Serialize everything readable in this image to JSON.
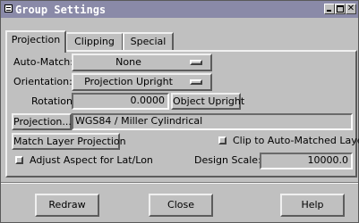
{
  "window": {
    "title": "Group Settings",
    "controls": [
      "minimize",
      "maximize",
      "close"
    ]
  },
  "tabs": [
    {
      "label": "Projection",
      "active": true
    },
    {
      "label": "Clipping",
      "active": false
    },
    {
      "label": "Special",
      "active": false
    }
  ],
  "projection_tab": {
    "auto_match_label": "Auto-Match:",
    "auto_match_value": "None",
    "orientation_label": "Orientation:",
    "orientation_value": "Projection Upright",
    "rotation_label": "Rotation:",
    "rotation_value": "0.0000",
    "object_upright_label": "Object Upright",
    "projection_button_label": "Projection...",
    "projection_value": "WGS84 / Miller Cylindrical",
    "match_layer_label": "Match Layer Projection",
    "clip_label": "Clip to Auto-Matched Layer",
    "clip_checked": false,
    "adjust_aspect_label": "Adjust Aspect for Lat/Lon",
    "adjust_aspect_checked": false,
    "design_scale_label": "Design Scale:",
    "design_scale_value": "10000.0"
  },
  "footer": {
    "redraw_label": "Redraw",
    "close_label": "Close",
    "help_label": "Help"
  }
}
